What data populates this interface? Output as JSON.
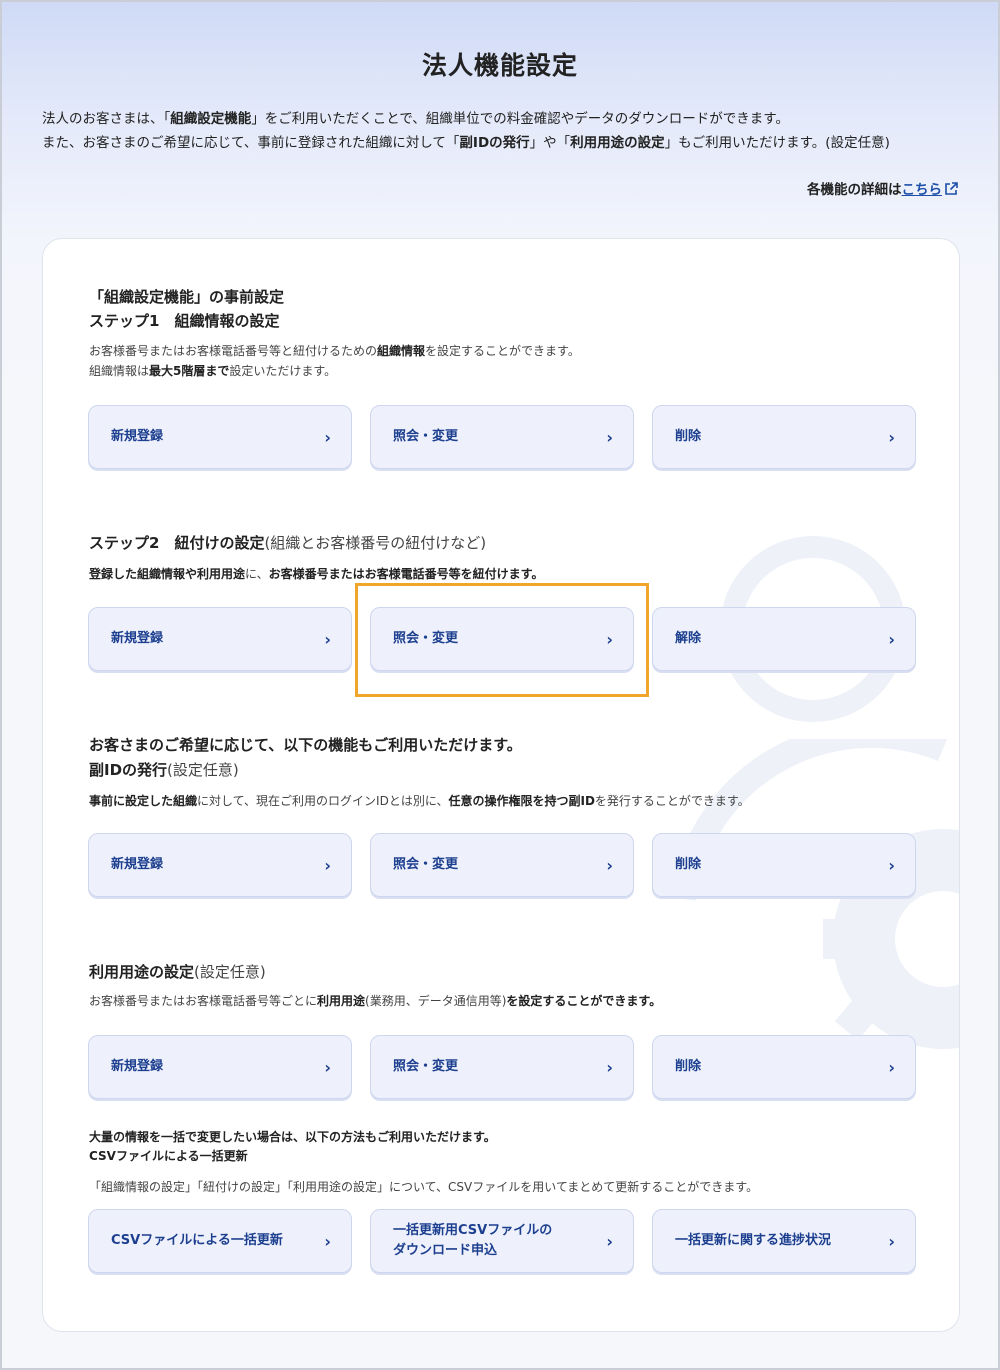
{
  "page": {
    "title": "法人機能設定",
    "intro_1_pre": "法人のお客さまは、「",
    "intro_1_bold": "組織設定機能",
    "intro_1_post": "」をご利用いただくことで、組織単位での料金確認やデータのダウンロードができます。",
    "intro_2_pre": "また、お客さまのご希望に応じて、事前に登録された組織に対して「",
    "intro_2_bold1": "副IDの発行",
    "intro_2_mid": "」や「",
    "intro_2_bold2": "利用用途の設定",
    "intro_2_post": "」もご利用いただけます。(設定任意)",
    "details_prefix": "各機能の詳細は",
    "details_link": "こちら"
  },
  "step1": {
    "heading_1": "「組織設定機能」の事前設定",
    "heading_2": "ステップ1　組織情報の設定",
    "desc_1_pre": "お客様番号またはお客様電話番号等と紐付けるための",
    "desc_1_bold": "組織情報",
    "desc_1_post": "を設定することができます。",
    "desc_2_pre": "組織情報は",
    "desc_2_bold": "最大5階層まで",
    "desc_2_post": "設定いただけます。",
    "buttons": [
      "新規登録",
      "照会・変更",
      "削除"
    ]
  },
  "step2": {
    "heading": "ステップ2　紐付けの設定",
    "heading_note": "(組織とお客様番号の紐付けなど)",
    "desc_bold1": "登録した組織情報や利用用途",
    "desc_mid": "に、",
    "desc_bold2": "お客様番号またはお客様電話番号等を紐付けます。",
    "buttons": [
      "新規登録",
      "照会・変更",
      "解除"
    ]
  },
  "subid": {
    "lead": "お客さまのご希望に応じて、以下の機能もご利用いただけます。",
    "heading": "副IDの発行",
    "heading_note": "(設定任意)",
    "desc_bold1": "事前に設定した組織",
    "desc_mid": "に対して、現在ご利用のログインIDとは別に、",
    "desc_bold2": "任意の操作権限を持つ副ID",
    "desc_post": "を発行することができます。",
    "buttons": [
      "新規登録",
      "照会・変更",
      "削除"
    ]
  },
  "usage": {
    "heading": "利用用途の設定",
    "heading_note": "(設定任意)",
    "desc_pre": "お客様番号またはお客様電話番号等ごとに",
    "desc_bold1": "利用用途",
    "desc_mid": "(業務用、データ通信用等)",
    "desc_bold2": "を設定することができます。",
    "buttons": [
      "新規登録",
      "照会・変更",
      "削除"
    ]
  },
  "csv": {
    "lead": "大量の情報を一括で変更したい場合は、以下の方法もご利用いただけます。",
    "heading": "CSVファイルによる一括更新",
    "desc": "「組織情報の設定」「紐付けの設定」「利用用途の設定」について、CSVファイルを用いてまとめて更新することができます。",
    "buttons": [
      "CSVファイルによる一括更新",
      "一括更新用CSVファイルの",
      "ダウンロード申込",
      "一括更新に関する進捗状況"
    ]
  },
  "icons": {
    "chevron": "chevron-right-icon",
    "external": "external-link-icon"
  },
  "colors": {
    "accent": "#1d3f8f",
    "highlight": "#f0a62a"
  }
}
